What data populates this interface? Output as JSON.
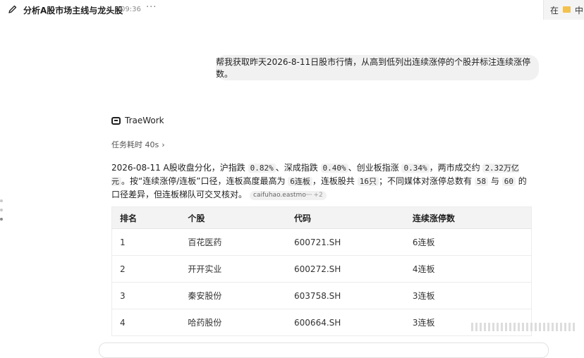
{
  "topbar": {
    "title": "分析A股市场主线与龙头股",
    "time": "09:36",
    "more": "···",
    "right_text_1": "在",
    "right_text_2": "中"
  },
  "user_message": "帮我获取昨天2026-8-11日股市行情，从高到低列出连续涨停的个股并标注连续涨停数。",
  "agent": {
    "name": "TraeWork",
    "task_time": "任务耗时 40s",
    "summary": {
      "p1": "2026-08-11 A股收盘分化，沪指跌 ",
      "c1": "0.82%",
      "p2": "、深成指跌 ",
      "c2": "0.40%",
      "p3": "、创业板指涨 ",
      "c3": "0.34%",
      "p4": "，两市成交约 ",
      "c4": "2.32万亿元",
      "p5": "。按“连续涨停/连板”口径，连板高度最高为 ",
      "c5": "6连板",
      "p6": "，连板股共 ",
      "c6": "16只",
      "p7": "；不同媒体对涨停总数有 ",
      "c7": "58",
      "p8": " 与 ",
      "c8": "60",
      "p9": " 的口径差异，但连板梯队可交叉核对。",
      "source": "caifuhao.eastmo···",
      "source_more": "+2"
    }
  },
  "table": {
    "headers": [
      "排名",
      "个股",
      "代码",
      "连续涨停数"
    ],
    "rows": [
      [
        "1",
        "百花医药",
        "600721.SH",
        "6连板"
      ],
      [
        "2",
        "开开实业",
        "600272.SH",
        "4连板"
      ],
      [
        "3",
        "秦安股份",
        "603758.SH",
        "3连板"
      ],
      [
        "4",
        "哈药股份",
        "600664.SH",
        "3连板"
      ]
    ]
  }
}
